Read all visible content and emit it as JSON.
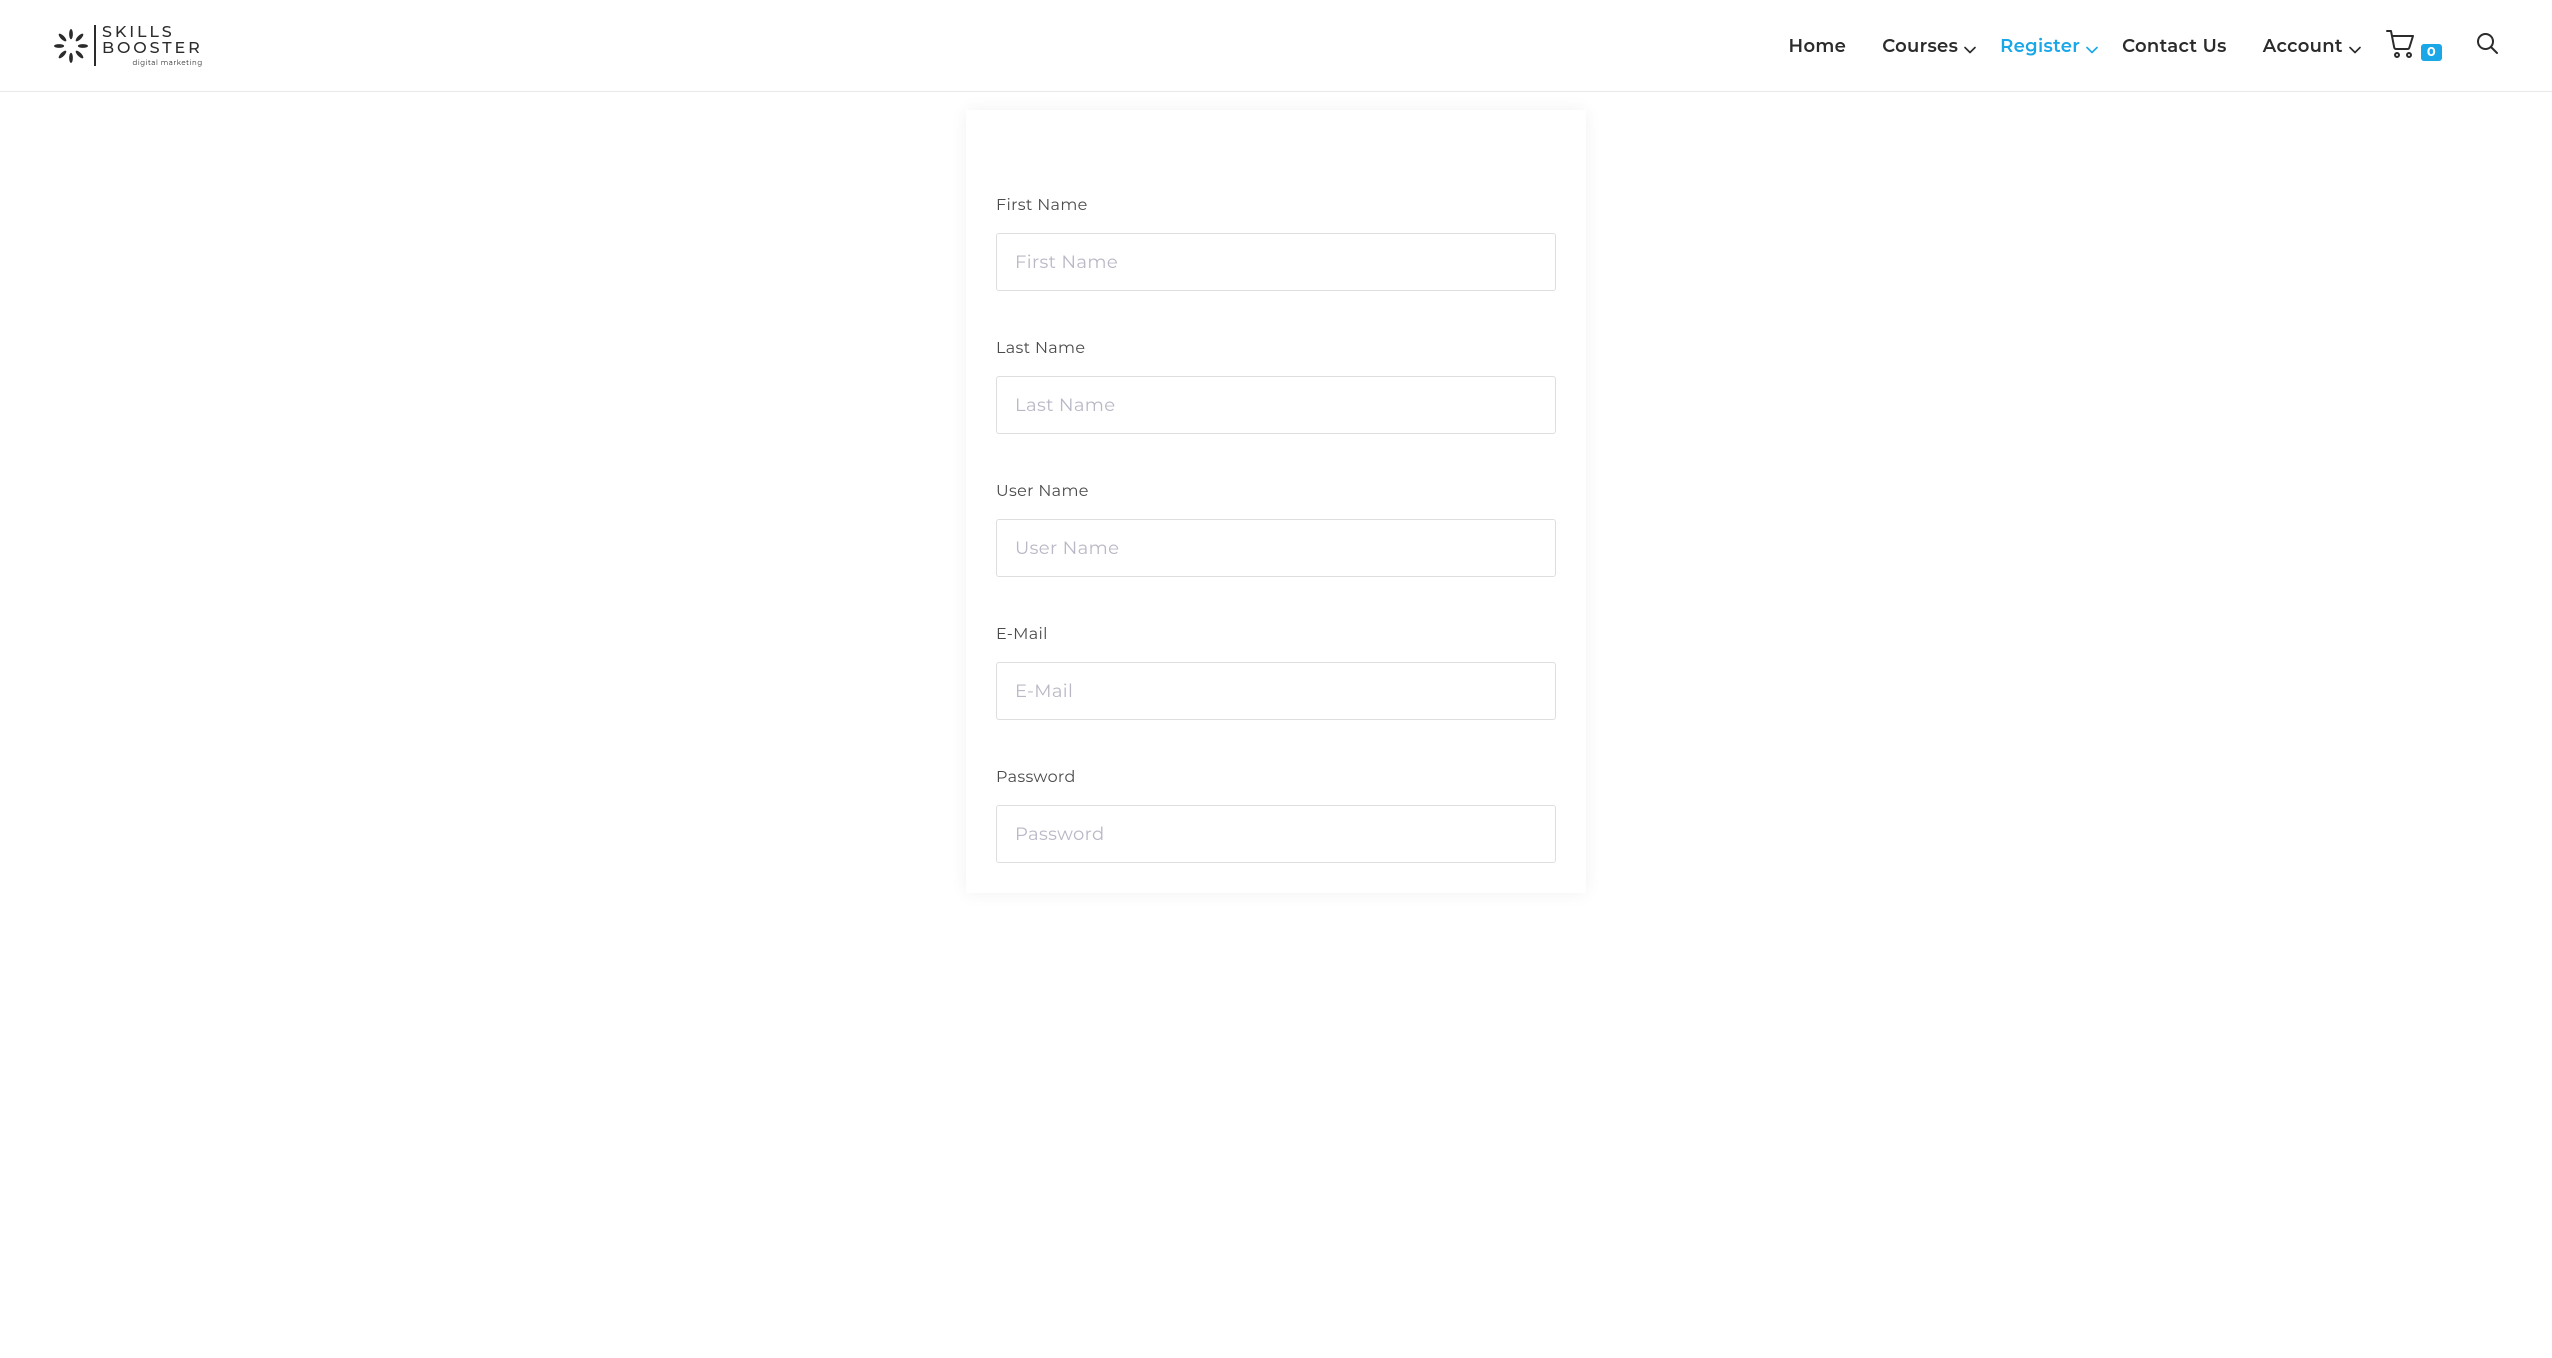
{
  "logo": {
    "line1": "SKILLS",
    "line2": "BOOSTER",
    "tagline": "digital marketing"
  },
  "nav": {
    "home": "Home",
    "courses": "Courses",
    "register": "Register",
    "contact": "Contact Us",
    "account": "Account"
  },
  "cart": {
    "count": "0"
  },
  "form": {
    "first_name": {
      "label": "First Name",
      "placeholder": "First Name",
      "value": ""
    },
    "last_name": {
      "label": "Last Name",
      "placeholder": "Last Name",
      "value": ""
    },
    "user_name": {
      "label": "User Name",
      "placeholder": "User Name",
      "value": ""
    },
    "email": {
      "label": "E-Mail",
      "placeholder": "E-Mail",
      "value": ""
    },
    "password": {
      "label": "Password",
      "placeholder": "Password",
      "value": ""
    }
  }
}
